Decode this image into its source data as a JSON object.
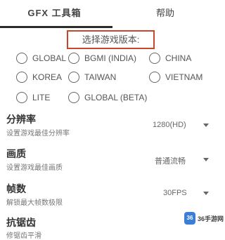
{
  "tabs": {
    "active_label": "GFX 工具箱",
    "inactive_label": "帮助"
  },
  "version_section": {
    "title": "选择游戏版本:",
    "options": [
      {
        "label": "GLOBAL",
        "selected": false
      },
      {
        "label": "BGMI (INDIA)",
        "selected": false
      },
      {
        "label": "CHINA",
        "selected": false
      },
      {
        "label": "KOREA",
        "selected": false
      },
      {
        "label": "TAIWAN",
        "selected": false
      },
      {
        "label": "VIETNAM",
        "selected": false
      },
      {
        "label": "LITE",
        "selected": false
      },
      {
        "label": "GLOBAL (BETA)",
        "selected": false
      }
    ]
  },
  "settings": {
    "resolution": {
      "title": "分辨率",
      "description": "设置游戏最佳分辨率",
      "value": "1280(HD)"
    },
    "graphics": {
      "title": "画质",
      "description": "设置游戏最佳画质",
      "value": "普通流畅"
    },
    "fps": {
      "title": "帧数",
      "description": "解锁最大帧数极限",
      "value": "30FPS"
    },
    "antialiasing": {
      "title": "抗锯齿",
      "description": "修锯齿平滑"
    }
  },
  "watermark": {
    "logo_text": "36",
    "site_text": "36手游网"
  },
  "colors": {
    "highlight_border": "#c8472b",
    "watermark_logo": "#3a7fd5"
  }
}
